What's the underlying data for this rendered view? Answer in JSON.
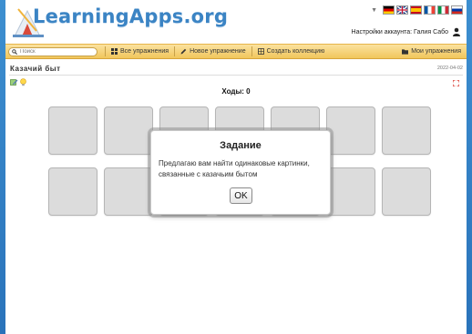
{
  "header": {
    "logo_text": "LearningApps.org",
    "account_label": "Настройки аккаунта: Галия Сабо",
    "languages": [
      "de",
      "en",
      "es",
      "fr",
      "it",
      "ru"
    ]
  },
  "navbar": {
    "search_placeholder": "Поиск",
    "items": [
      {
        "label": "Все упражнения",
        "icon": "grid-icon"
      },
      {
        "label": "Новое упражнение",
        "icon": "pencil-icon"
      },
      {
        "label": "Создать коллекцию",
        "icon": "collection-icon"
      }
    ],
    "right_item": {
      "label": "Мои упражнения",
      "icon": "folder-icon"
    }
  },
  "page": {
    "title": "Казачий быт",
    "date": "2022-04-02"
  },
  "game": {
    "moves_label": "Ходы: 0",
    "card_count": 14
  },
  "modal": {
    "title": "Задание",
    "text": "Предлагаю вам найти одинаковые картинки, связанные с казачьим бытом",
    "ok_label": "OK"
  },
  "colors": {
    "background": "#2a73ba",
    "navbar": "#f1c65b",
    "logo": "#3b84c4",
    "card": "#dcdcdc"
  }
}
